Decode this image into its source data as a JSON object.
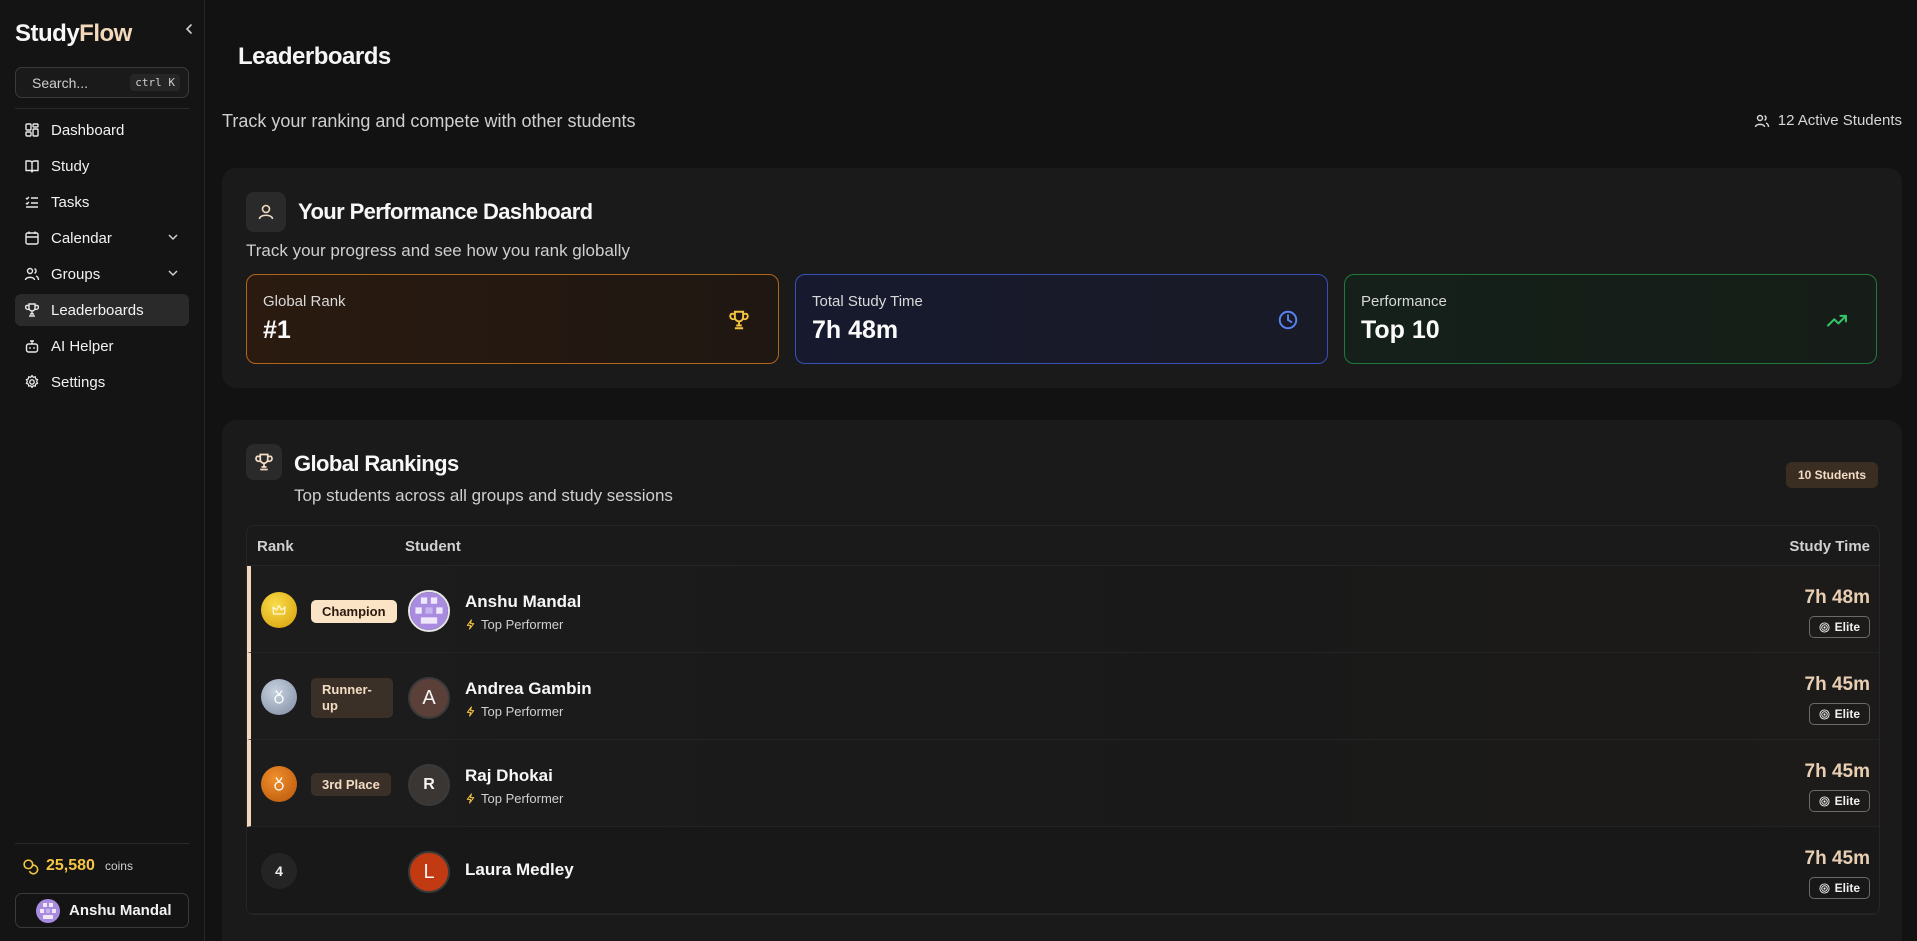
{
  "app": {
    "name_part1": "Study",
    "name_part2": "Flow"
  },
  "search": {
    "placeholder": "Search...",
    "shortcut": "ctrl K"
  },
  "nav": {
    "items": [
      {
        "label": "Dashboard",
        "icon": "grid-icon"
      },
      {
        "label": "Study",
        "icon": "book-icon"
      },
      {
        "label": "Tasks",
        "icon": "checklist-icon"
      },
      {
        "label": "Calendar",
        "icon": "calendar-icon"
      },
      {
        "label": "Groups",
        "icon": "users-icon"
      },
      {
        "label": "Leaderboards",
        "icon": "trophy-icon"
      },
      {
        "label": "AI Helper",
        "icon": "robot-icon"
      },
      {
        "label": "Settings",
        "icon": "gear-icon"
      }
    ]
  },
  "wallet": {
    "coins": "25,580",
    "unit": "coins"
  },
  "user": {
    "name": "Anshu Mandal"
  },
  "page": {
    "title": "Leaderboards",
    "subtitle": "Track your ranking and compete with other students",
    "active_students": "12 Active Students"
  },
  "performance": {
    "title": "Your Performance Dashboard",
    "subtitle": "Track your progress and see how you rank globally",
    "stats": {
      "rank": {
        "label": "Global Rank",
        "value": "#1"
      },
      "time": {
        "label": "Total Study Time",
        "value": "7h 48m"
      },
      "perf": {
        "label": "Performance",
        "value": "Top 10"
      }
    }
  },
  "rankings": {
    "title": "Global Rankings",
    "subtitle": "Top students across all groups and study sessions",
    "count": "10 Students",
    "columns": {
      "rank": "Rank",
      "student": "Student",
      "time": "Study Time"
    },
    "rows": [
      {
        "rank": "1",
        "label": "Champion",
        "name": "Anshu Mandal",
        "initial": "",
        "tag": "Top Performer",
        "time": "7h 48m",
        "tier": "Elite"
      },
      {
        "rank": "2",
        "label": "Runner-up",
        "name": "Andrea Gambin",
        "initial": "A",
        "tag": "Top Performer",
        "time": "7h 45m",
        "tier": "Elite"
      },
      {
        "rank": "3",
        "label": "3rd Place",
        "name": "Raj Dhokai",
        "initial": "R",
        "tag": "Top Performer",
        "time": "7h 45m",
        "tier": "Elite"
      },
      {
        "rank": "4",
        "label": "",
        "name": "Laura Medley",
        "initial": "L",
        "tag": "",
        "time": "7h 45m",
        "tier": "Elite"
      }
    ]
  },
  "colors": {
    "accent": "#f3d9bc",
    "gold": "#f5c542",
    "blue": "#3650b8",
    "green": "#1f7a3c",
    "bronze": "#b0661a"
  }
}
